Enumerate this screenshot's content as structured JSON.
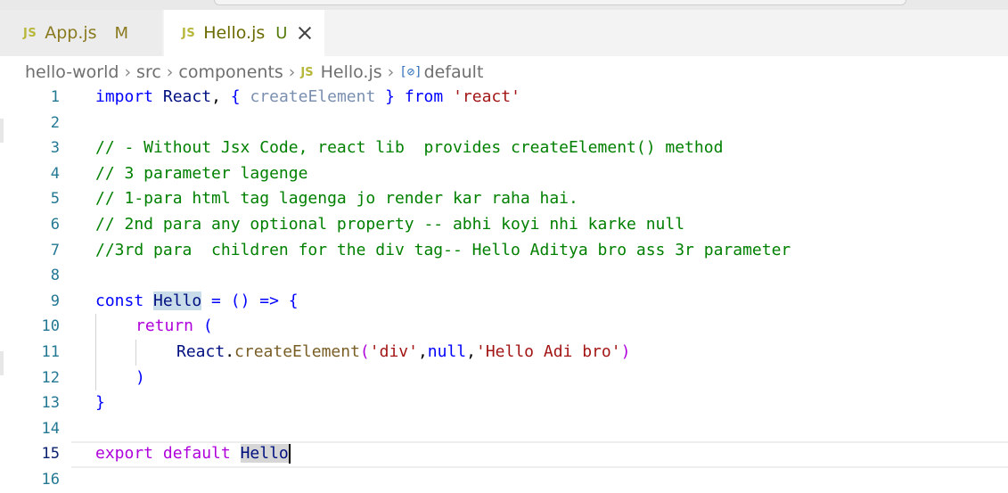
{
  "tabs": [
    {
      "icon": "JS",
      "label": "App.js",
      "status": "M"
    },
    {
      "icon": "JS",
      "label": "Hello.js",
      "status": "U"
    }
  ],
  "breadcrumb": {
    "folders": [
      "hello-world",
      "src",
      "components"
    ],
    "file_icon": "JS",
    "file": "Hello.js",
    "symbol_icon": "[⊘]",
    "symbol": "default"
  },
  "editor": {
    "line_numbers": [
      "1",
      "2",
      "3",
      "4",
      "5",
      "6",
      "7",
      "8",
      "9",
      "10",
      "11",
      "12",
      "13",
      "14",
      "15",
      "16"
    ],
    "line1": {
      "import": "import",
      "react": "React",
      "comma": ", ",
      "lb": "{",
      "createElement": "createElement",
      "rb": "}",
      "from": "from",
      "module": "'react'"
    },
    "line3": "// - Without Jsx Code, react lib  provides createElement() method",
    "line4": "// 3 parameter lagenge",
    "line5": "// 1-para html tag lagenga jo render kar raha hai.",
    "line6": "// 2nd para any optional property -- abhi koyi nhi karke null",
    "line7": "//3rd para  children for the div tag-- Hello Aditya bro ass 3r parameter",
    "line9": {
      "const": "const",
      "name": "Hello",
      "rest": " = () => {"
    },
    "line10": {
      "return": "return",
      "paren": " ("
    },
    "line11": {
      "react": "React",
      "dot": ".",
      "fn": "createElement",
      "open": "(",
      "arg1": "'div'",
      "comma1": ",",
      "arg2": "null",
      "comma2": ",",
      "arg3": "'Hello Adi bro'",
      "close": ")"
    },
    "line12": ")",
    "line13": "}",
    "line15": {
      "export": "export",
      "default": "default",
      "name": "Hello"
    }
  }
}
